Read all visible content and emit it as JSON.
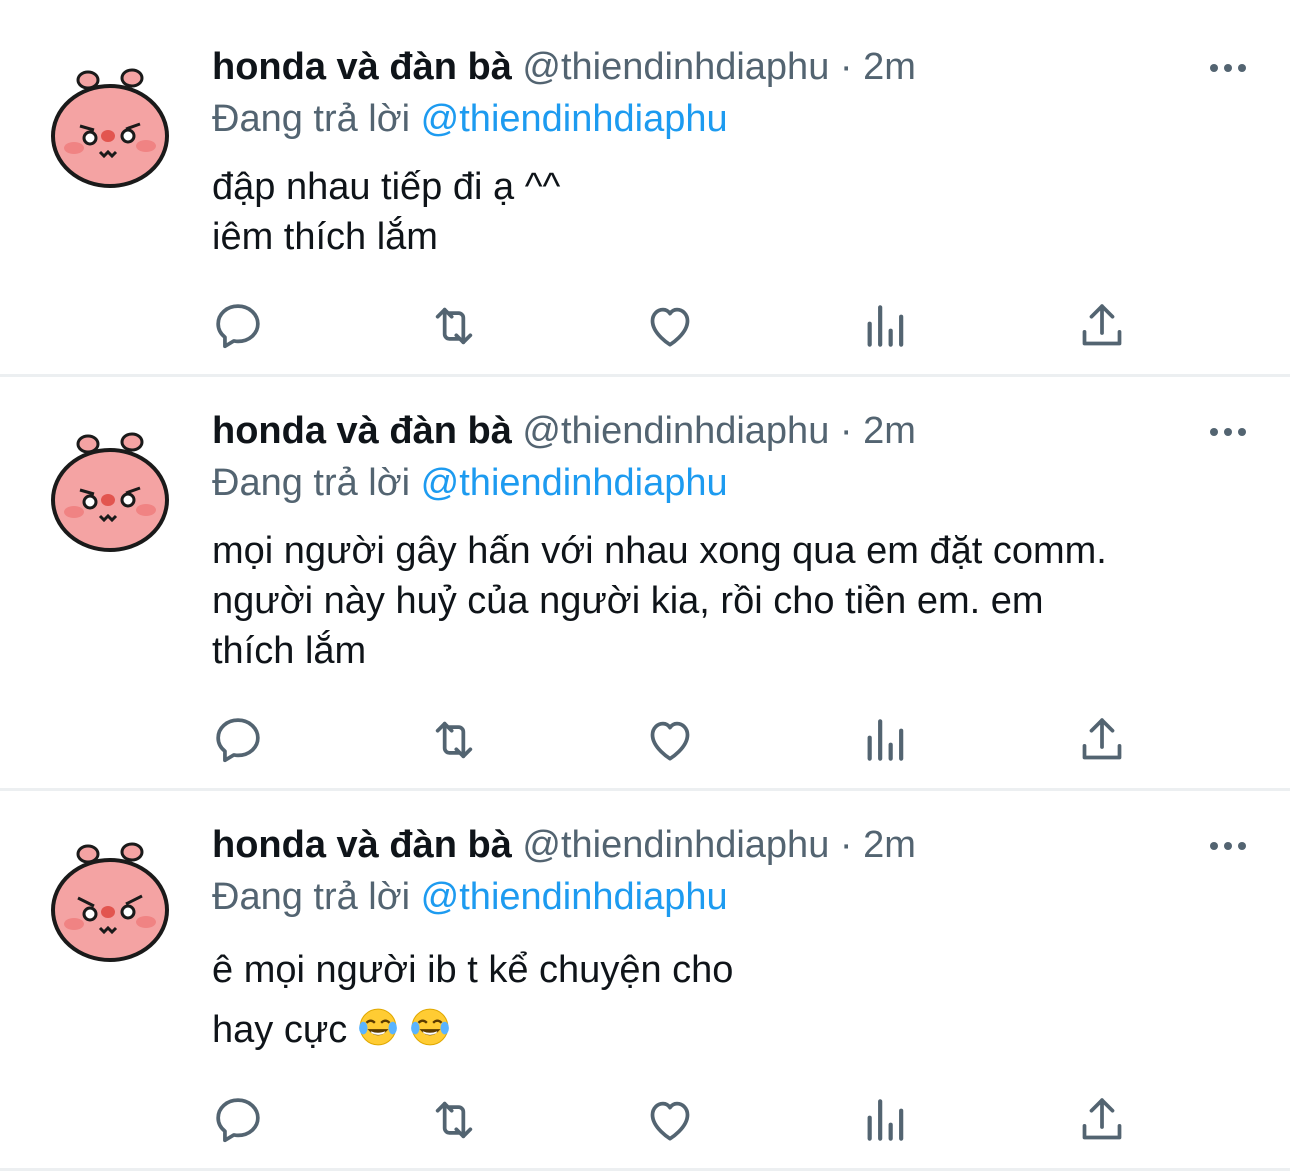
{
  "tweets": [
    {
      "author_name": "honda và đàn bà",
      "handle": "@thiendinhdiaphu",
      "separator": "·",
      "time": "2m",
      "reply_prefix": "Đang trả lời",
      "reply_to": "@thiendinhdiaphu",
      "text_lines": [
        "đập nhau tiếp đi ạ ^^",
        "iêm thích lắm"
      ]
    },
    {
      "author_name": "honda và đàn bà",
      "handle": "@thiendinhdiaphu",
      "separator": "·",
      "time": "2m",
      "reply_prefix": "Đang trả lời",
      "reply_to": "@thiendinhdiaphu",
      "text_lines": [
        "mọi người gây hấn với nhau xong qua em đặt comm.",
        "người này huỷ của người kia, rồi cho tiền em. em",
        "thích lắm"
      ]
    },
    {
      "author_name": "honda và đàn bà",
      "handle": "@thiendinhdiaphu",
      "separator": "·",
      "time": "2m",
      "reply_prefix": "Đang trả lời",
      "reply_to": "@thiendinhdiaphu",
      "text_lines": [
        "ê mọi người ib t kể chuyện cho",
        "hay cực"
      ],
      "trailing_emojis": [
        "face-with-tears-of-joy",
        "face-with-tears-of-joy"
      ]
    }
  ],
  "action_icons": [
    "reply-icon",
    "retweet-icon",
    "like-icon",
    "views-icon",
    "share-icon"
  ],
  "colors": {
    "text": "#0f1419",
    "secondary": "#536471",
    "link": "#1d9bf0",
    "divider": "#eceff1",
    "avatar_pink": "#f4a3a3",
    "icon": "#536471"
  }
}
